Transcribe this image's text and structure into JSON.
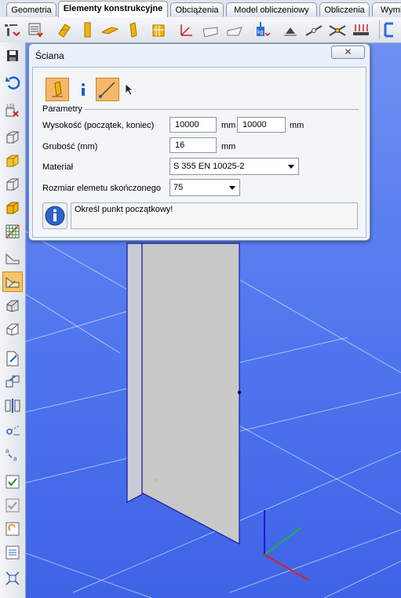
{
  "tabs": [
    {
      "label": "Geometria",
      "active": false
    },
    {
      "label": "Elementy konstrukcyjne",
      "active": true
    },
    {
      "label": "Obciążenia",
      "active": false
    },
    {
      "label": "Model obliczeniowy",
      "active": false
    },
    {
      "label": "Obliczenia",
      "active": false
    },
    {
      "label": "Wymi",
      "active": false
    }
  ],
  "dialog": {
    "title": "Ściana",
    "section_title": "Parametry",
    "height": {
      "label": "Wysokość (początek, koniec)",
      "start_value": "10000",
      "end_value": "10000",
      "unit": "mm"
    },
    "thickness": {
      "label": "Grubość (mm)",
      "value": "16",
      "unit": "mm"
    },
    "material": {
      "label": "Materiał",
      "selected": "S 355 EN 10025-2"
    },
    "fe_size": {
      "label": "Rozmiar elemetu skończonego",
      "selected": "75"
    },
    "message": "Określ punkt początkowy!"
  },
  "colors": {
    "accent": "#f6b868",
    "viewport_top": "#6f8ff2",
    "viewport_bottom": "#3e63e6",
    "wall": "#c9c9c9",
    "axis_x": "#e02020",
    "axis_y": "#20b040",
    "axis_z": "#1a1ad0"
  }
}
